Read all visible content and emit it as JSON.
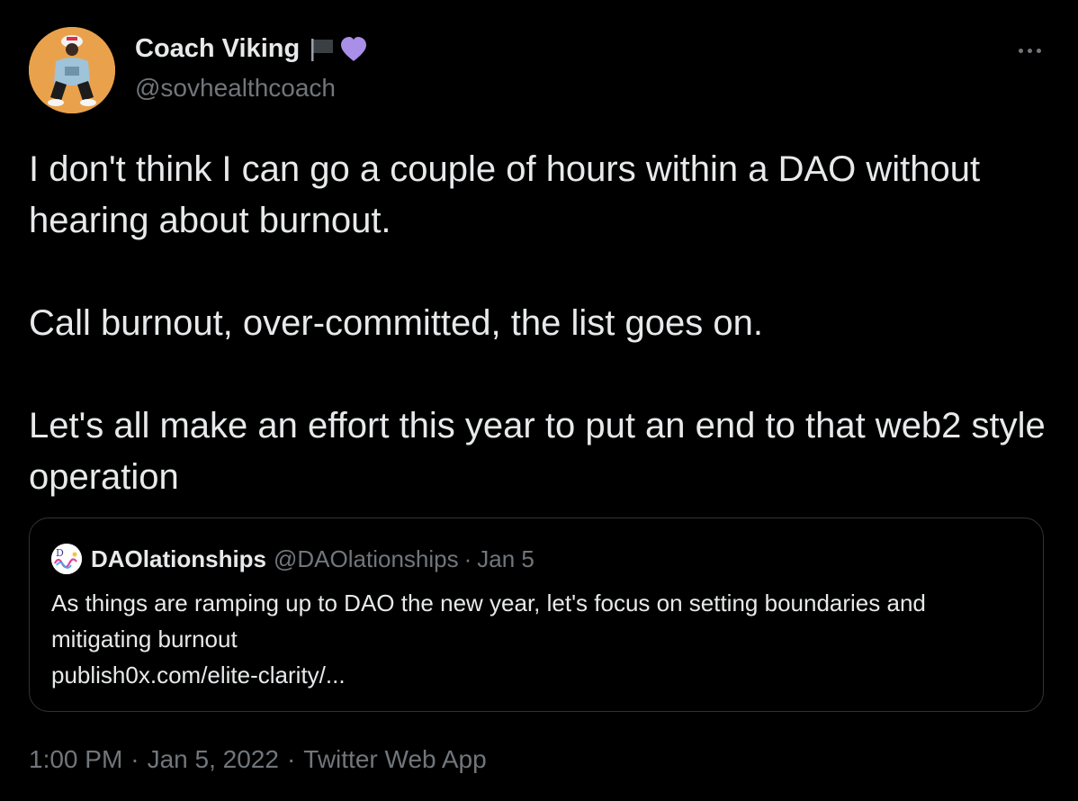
{
  "author": {
    "name": "Coach Viking",
    "handle": "@sovhealthcoach",
    "avatar_color": "#e9a24b"
  },
  "tweet": {
    "paragraphs": [
      "I don't think I can go a couple of hours within a DAO without hearing about burnout.",
      "Call burnout, over-committed, the list goes on.",
      "Let's all make an effort this year to put an end to that web2 style operation"
    ]
  },
  "quoted_tweet": {
    "name": "DAOlationships",
    "handle": "@DAOlationships",
    "separator": "·",
    "date": "Jan 5",
    "text": "As things are ramping up to DAO the new year, let's focus on setting boundaries and mitigating burnout",
    "link": "publish0x.com/elite-clarity/..."
  },
  "meta": {
    "time": "1:00 PM",
    "date": "Jan 5, 2022",
    "source": "Twitter Web App",
    "separator": "·"
  },
  "icons": {
    "more": "more-horizontal-icon",
    "flag": "black-flag-icon",
    "heart": "purple-heart-icon"
  },
  "colors": {
    "background": "#000000",
    "primary_text": "#e7e9ea",
    "secondary_text": "#71767b",
    "border": "#2f3336",
    "heart": "#a98fe8"
  }
}
